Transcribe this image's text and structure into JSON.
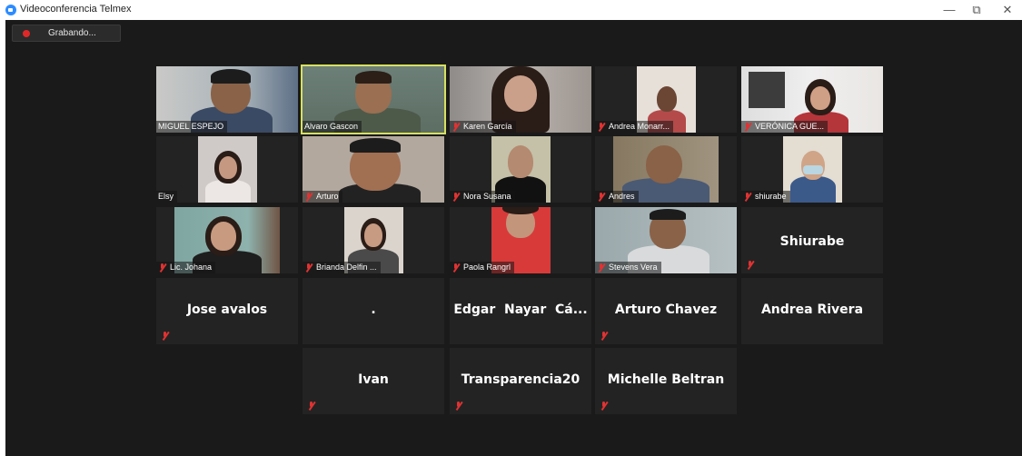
{
  "window": {
    "title": "Videoconferencia Telmex",
    "minimize_icon": "—",
    "restore_icon": "⧉",
    "close_icon": "✕"
  },
  "recording": {
    "label": "Grabando..."
  },
  "participants": [
    {
      "name": "MIGUEL ESPEJO",
      "muted": false
    },
    {
      "name": "Alvaro Gascon",
      "muted": false,
      "active_speaker": true
    },
    {
      "name": "Karen García",
      "muted": true
    },
    {
      "name": "Andrea Monarr...",
      "muted": true
    },
    {
      "name": "VERÓNICA GUE...",
      "muted": true
    },
    {
      "name": "Elsy",
      "muted": false
    },
    {
      "name": "Arturo",
      "muted": true
    },
    {
      "name": "Nora Susana",
      "muted": true
    },
    {
      "name": "Andres",
      "muted": true
    },
    {
      "name": "shiurabe",
      "muted": true
    },
    {
      "name": "Lic. Johana",
      "muted": true
    },
    {
      "name": "Brianda Delfin ...",
      "muted": true
    },
    {
      "name": "Paola Rangrl",
      "muted": true
    },
    {
      "name": "Stevens Vera",
      "muted": true
    },
    {
      "name": "Shiurabe",
      "muted": true
    },
    {
      "name": "Jose avalos",
      "muted": true
    },
    {
      "name": ".",
      "muted": false
    },
    {
      "name": "Edgar  Nayar  Cá...",
      "muted": false
    },
    {
      "name": "Arturo Chavez",
      "muted": true
    },
    {
      "name": "Andrea Rivera",
      "muted": false
    },
    {
      "name": "Ivan",
      "muted": true
    },
    {
      "name": "Transparencia20",
      "muted": true
    },
    {
      "name": "Michelle Beltran",
      "muted": true
    }
  ],
  "colors": {
    "active_border": "#d7e060",
    "muted_icon": "#e03232",
    "meeting_bg": "#1a1a1a",
    "tile_bg": "#232323"
  }
}
